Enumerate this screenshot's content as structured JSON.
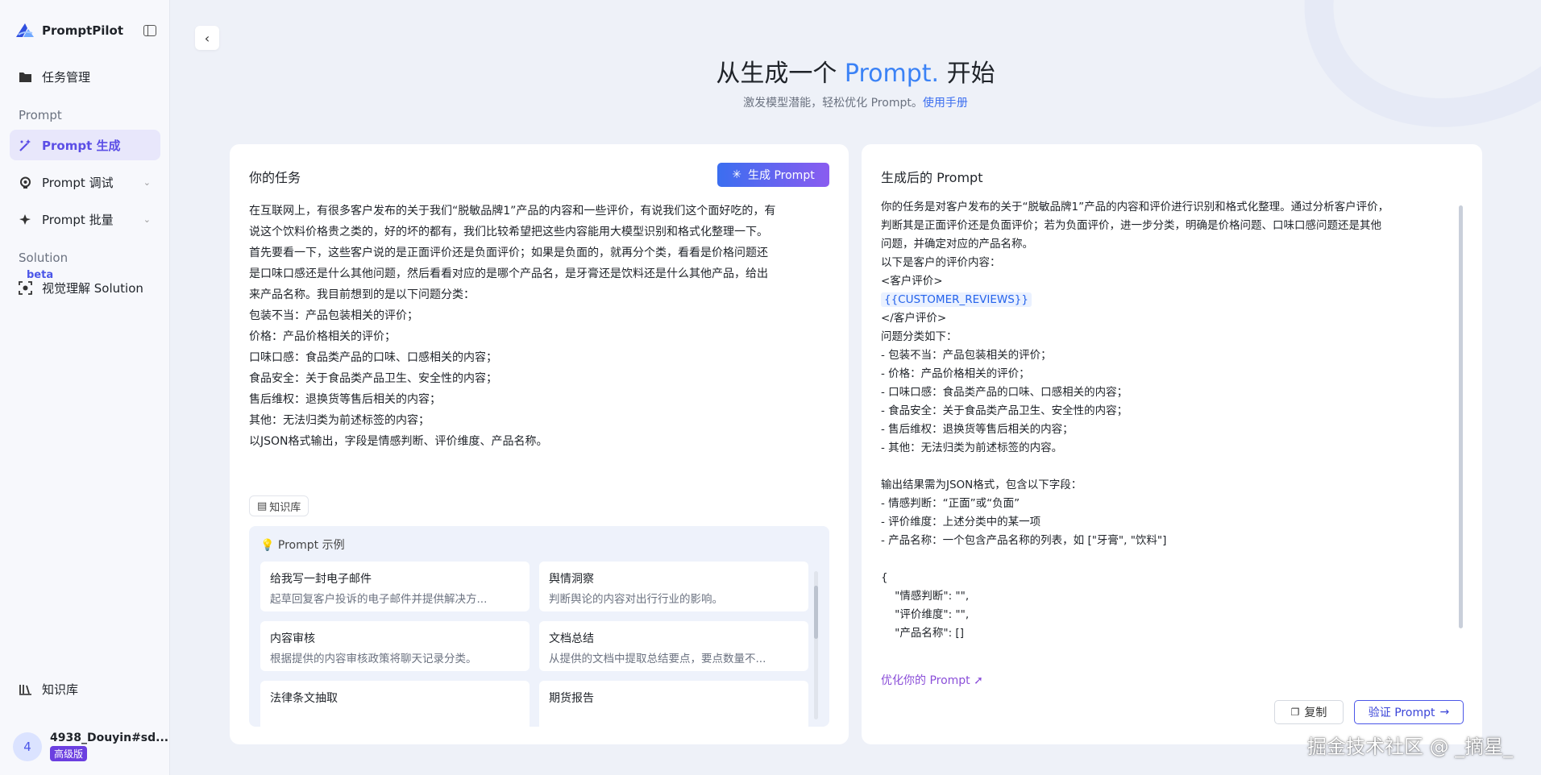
{
  "app": {
    "name": "PromptPilot"
  },
  "sidebar": {
    "items": [
      {
        "label": "任务管理",
        "icon": "folder-icon"
      },
      {
        "label": "Prompt 生成",
        "icon": "magic-wand-icon",
        "active": true
      },
      {
        "label": "Prompt 调试",
        "icon": "bulb-icon"
      },
      {
        "label": "Prompt 批量",
        "icon": "sparkle-stack-icon"
      },
      {
        "label": "视觉理解 Solution",
        "icon": "scan-eye-icon"
      },
      {
        "label": "知识库",
        "icon": "books-icon"
      }
    ],
    "section_prompt": "Prompt",
    "section_solution": "Solution",
    "beta_label": "beta",
    "user": {
      "avatar": "4",
      "name": "4938_Douyin#sd...",
      "badge": "高级版"
    }
  },
  "hero": {
    "title_before": "从生成一个 ",
    "title_accent": "Prompt.",
    "title_after": " 开始",
    "subtitle": "激发模型潜能，轻松优化 Prompt。",
    "manual_link": "使用手册"
  },
  "task": {
    "title": "你的任务",
    "generate_button": "生成 Prompt",
    "text": "在互联网上，有很多客户发布的关于我们“脱敏品牌1”产品的内容和一些评价，有说我们这个面好吃的，有\n说这个饮料价格贵之类的，好的坏的都有，我们比较希望把这些内容能用大模型识别和格式化整理一下。\n首先要看一下，这些客户说的是正面评价还是负面评价；如果是负面的，就再分个类，看看是价格问题还\n是口味口感还是什么其他问题，然后看看对应的是哪个产品名，是牙膏还是饮料还是什么其他产品，给出\n来产品名称。我目前想到的是以下问题分类：\n包装不当：产品包装相关的评价；\n价格：产品价格相关的评价；\n口味口感：食品类产品的口味、口感相关的内容；\n食品安全：关于食品类产品卫生、安全性的内容；\n售后维权：退换货等售后相关的内容；\n其他：无法归类为前述标签的内容；\n以JSON格式输出，字段是情感判断、评价维度、产品名称。",
    "knowledge_chip": "知识库",
    "examples_title": "Prompt 示例",
    "examples": [
      {
        "title": "给我写一封电子邮件",
        "desc": "起草回复客户投诉的电子邮件并提供解决方..."
      },
      {
        "title": "舆情洞察",
        "desc": "判断舆论的内容对出行行业的影响。"
      },
      {
        "title": "内容审核",
        "desc": "根据提供的内容审核政策将聊天记录分类。"
      },
      {
        "title": "文档总结",
        "desc": "从提供的文档中提取总结要点，要点数量不..."
      },
      {
        "title": "法律条文抽取",
        "desc": ""
      },
      {
        "title": "期货报告",
        "desc": ""
      }
    ]
  },
  "result": {
    "title": "生成后的 Prompt",
    "text_part1": "你的任务是对客户发布的关于“脱敏品牌1”产品的内容和评价进行识别和格式化整理。通过分析客户评价，\n判断其是正面评价还是负面评价；若为负面评价，进一步分类，明确是价格问题、口味口感问题还是其他\n问题，并确定对应的产品名称。\n以下是客户的评价内容：\n<客户评价>\n",
    "variable": "{{CUSTOMER_REVIEWS}}",
    "text_part2": "\n</客户评价>\n问题分类如下：\n- 包装不当：产品包装相关的评价；\n- 价格：产品价格相关的评价；\n- 口味口感：食品类产品的口味、口感相关的内容；\n- 食品安全：关于食品类产品卫生、安全性的内容；\n- 售后维权：退换货等售后相关的内容；\n- 其他：无法归类为前述标签的内容。\n\n输出结果需为JSON格式，包含以下字段：\n- 情感判断：“正面”或“负面”\n- 评价维度：上述分类中的某一项\n- 产品名称：一个包含产品名称的列表，如 [\"牙膏\", \"饮料\"]\n\n{\n    \"情感判断\": \"\",\n    \"评价维度\": \"\",\n    \"产品名称\": []\n}",
    "optimize_link": "优化你的 Prompt",
    "copy_button": "复制",
    "verify_button": "验证 Prompt"
  },
  "watermark": "掘金技术社区 @ _摘星_"
}
